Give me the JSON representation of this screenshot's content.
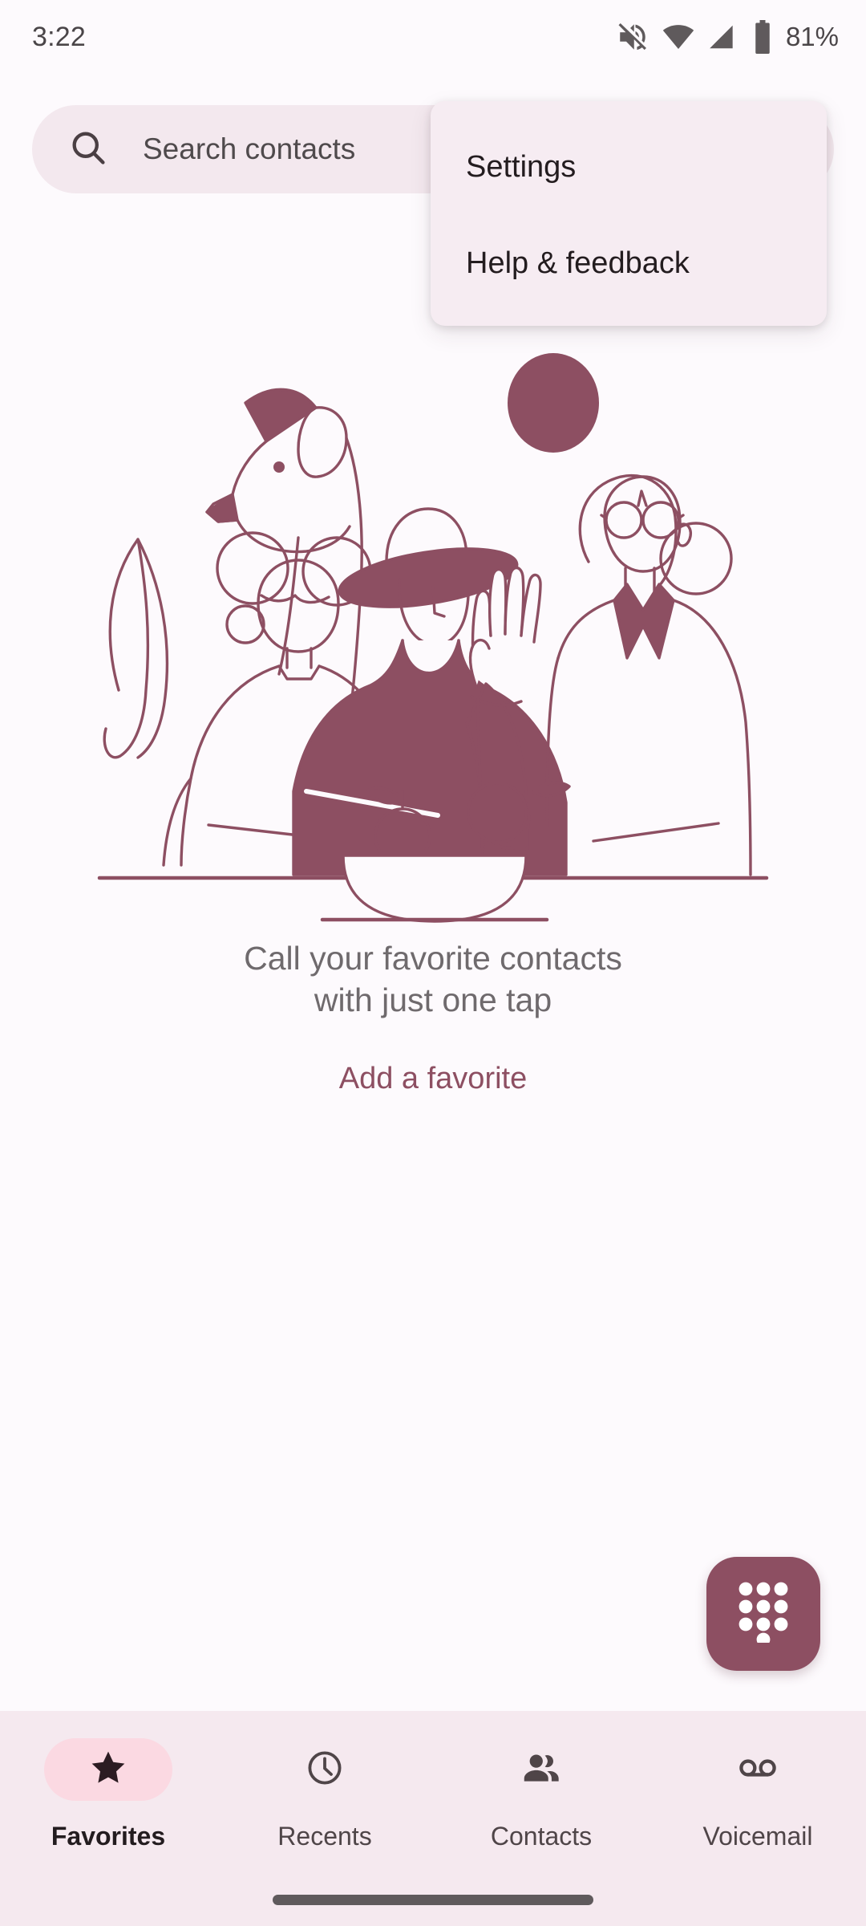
{
  "status_bar": {
    "time": "3:22",
    "battery_percent": "81%",
    "icons": [
      "volume-mute-icon",
      "wifi-icon",
      "cellular-signal-icon",
      "battery-icon"
    ]
  },
  "search": {
    "placeholder": "Search contacts",
    "value": "",
    "icon": "search-icon"
  },
  "overflow_menu": {
    "visible": true,
    "items": [
      {
        "label": "Settings"
      },
      {
        "label": "Help & feedback"
      }
    ]
  },
  "empty_state": {
    "illustration_name": "family-waving-illustration",
    "title_line_1": "Call your favorite contacts",
    "title_line_2": "with just one tap",
    "action_label": "Add a favorite"
  },
  "fab": {
    "name": "dialpad-fab",
    "icon": "dialpad-icon"
  },
  "bottom_nav": {
    "tabs": [
      {
        "label": "Favorites",
        "icon": "star-icon",
        "active": true
      },
      {
        "label": "Recents",
        "icon": "clock-icon",
        "active": false
      },
      {
        "label": "Contacts",
        "icon": "people-icon",
        "active": false
      },
      {
        "label": "Voicemail",
        "icon": "voicemail-icon",
        "active": false
      }
    ]
  },
  "colors": {
    "accent": "#8d4f62",
    "page_background": "#fdfafd",
    "search_background": "#f3e8ee",
    "menu_background": "#f6ecf2",
    "nav_background": "#f5e9ef",
    "active_pill": "#fbd9e2",
    "muted_text": "#6f6a6d",
    "home_indicator": "#5f5a5c"
  }
}
